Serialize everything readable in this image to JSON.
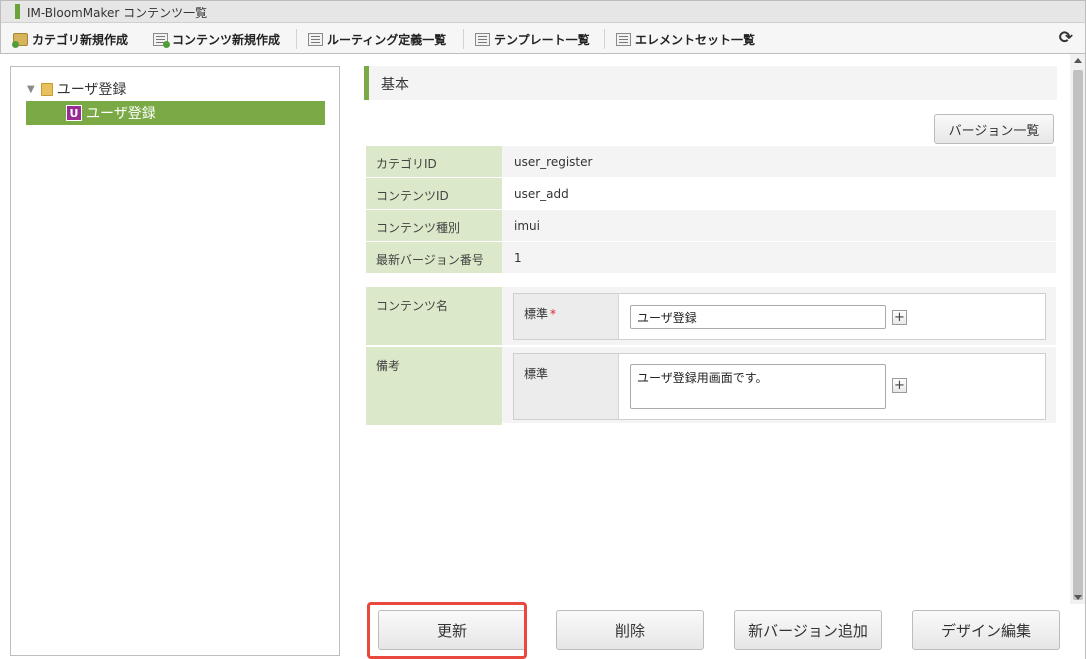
{
  "window": {
    "title": "IM-BloomMaker コンテンツ一覧"
  },
  "toolbar": {
    "items": [
      {
        "label": "カテゴリ新規作成",
        "icon": "folder-add-icon"
      },
      {
        "label": "コンテンツ新規作成",
        "icon": "document-add-icon"
      },
      {
        "label": "ルーティング定義一覧",
        "icon": "list-icon"
      },
      {
        "label": "テンプレート一覧",
        "icon": "list-icon"
      },
      {
        "label": "エレメントセット一覧",
        "icon": "list-icon"
      }
    ],
    "refresh_icon": "⟳"
  },
  "tree": {
    "root": {
      "label": "ユーザ登録",
      "icon": "folder-icon"
    },
    "child": {
      "label": "ユーザ登録",
      "badge": "U",
      "selected": true
    }
  },
  "section": {
    "title": "基本"
  },
  "buttons": {
    "version_list": "バージョン一覧",
    "update": "更新",
    "delete": "削除",
    "add_version": "新バージョン追加",
    "design_edit": "デザイン編集"
  },
  "info": [
    {
      "label": "カテゴリID",
      "value": "user_register"
    },
    {
      "label": "コンテンツID",
      "value": "user_add"
    },
    {
      "label": "コンテンツ種別",
      "value": "imui"
    },
    {
      "label": "最新バージョン番号",
      "value": "1"
    }
  ],
  "form": {
    "content_name": {
      "label": "コンテンツ名",
      "sub_label": "標準",
      "required_mark": "*",
      "value": "ユーザ登録",
      "add_button": "+"
    },
    "remarks": {
      "label": "備考",
      "sub_label": "標準",
      "value": "ユーザ登録用画面です。",
      "add_button": "+"
    }
  },
  "colors": {
    "accent": "#7aa946",
    "label_bg": "#dbe8c9",
    "highlight": "#e8483e",
    "badge": "#9a2b95"
  }
}
